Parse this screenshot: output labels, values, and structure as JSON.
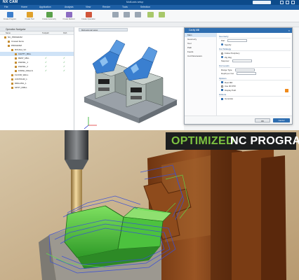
{
  "window": {
    "app_name": "NX CAM",
    "title": "Multi-axis setup"
  },
  "menu": [
    "File",
    "Home",
    "Application",
    "Analysis",
    "View",
    "Render",
    "Tools",
    "Selection"
  ],
  "ribbon_tools": [
    "Create Program",
    "Create Tool",
    "Create Geometry",
    "Create Method",
    "Create Operation"
  ],
  "navigator": {
    "title": "Operation Navigator",
    "columns": [
      "Name",
      "Toolpath",
      "Path"
    ],
    "rows": [
      {
        "label": "NC_PROGRAM",
        "indent": 0,
        "check": false
      },
      {
        "label": "Unused Items",
        "indent": 1,
        "check": false
      },
      {
        "label": "PROGRAM",
        "indent": 1,
        "check": false
      },
      {
        "label": "ROUGH_VC",
        "indent": 2,
        "check": false
      },
      {
        "label": "CAVITY_MILL",
        "indent": 3,
        "check": false
      },
      {
        "label": "REST_MILL",
        "indent": 3,
        "check": true
      },
      {
        "label": "ZLEVEL_1",
        "indent": 3,
        "check": true
      },
      {
        "label": "ZLEVEL_2",
        "indent": 3,
        "check": true
      },
      {
        "label": "FINISH_WALLS",
        "indent": 3,
        "check": true
      },
      {
        "label": "FLOOR_WALL",
        "indent": 2,
        "check": false
      },
      {
        "label": "CONTOUR_1",
        "indent": 2,
        "check": false
      },
      {
        "label": "DRILLING_1",
        "indent": 2,
        "check": false
      },
      {
        "label": "SPOT_DRILL",
        "indent": 2,
        "check": false
      }
    ]
  },
  "viewport": {
    "tab_label": "Multi-axis part setup"
  },
  "dialog": {
    "title": "Cavity Mill",
    "list": [
      "Main",
      "Geometry",
      "Tool",
      "Path",
      "Feeds",
      "Cut Parameters"
    ],
    "sections": [
      {
        "heading": "Geometry",
        "options": [
          {
            "type": "field",
            "label": "Part"
          },
          {
            "type": "radio",
            "label": "Specify",
            "on": true
          }
        ]
      },
      {
        "heading": "Cut Strategy",
        "options": [
          {
            "type": "radio",
            "label": "Follow Periphery",
            "on": false
          },
          {
            "type": "radio",
            "label": "Zig Zag",
            "on": true
          },
          {
            "type": "field",
            "label": "Stepover"
          }
        ]
      },
      {
        "heading": "Cut Levels",
        "options": [
          {
            "type": "field",
            "label": "Range Type"
          },
          {
            "type": "field",
            "label": "Depth per Cut"
          }
        ]
      },
      {
        "heading": "Options",
        "options": [
          {
            "type": "checkbox",
            "label": "Rest Mill",
            "on": true
          },
          {
            "type": "checkbox",
            "label": "Use 3D IPW",
            "on": false
          },
          {
            "type": "checkbox",
            "label": "Display Path",
            "on": true,
            "warn": true
          }
        ]
      },
      {
        "heading": "Actions",
        "options": [
          {
            "type": "checkbox",
            "label": "Generate",
            "on": true
          }
        ]
      }
    ],
    "ok_label": "OK",
    "cancel_label": "Cancel"
  },
  "banner": {
    "word1": "OPTIMIZED",
    "word2": "NC PROGRAM"
  },
  "colors": {
    "nx_blue": "#1d5fa5",
    "banner_green": "#7dc241",
    "toolpath_green": "#46c43a",
    "part_blue": "#3a7fd0",
    "mold_brown": "#8a4a1c"
  }
}
